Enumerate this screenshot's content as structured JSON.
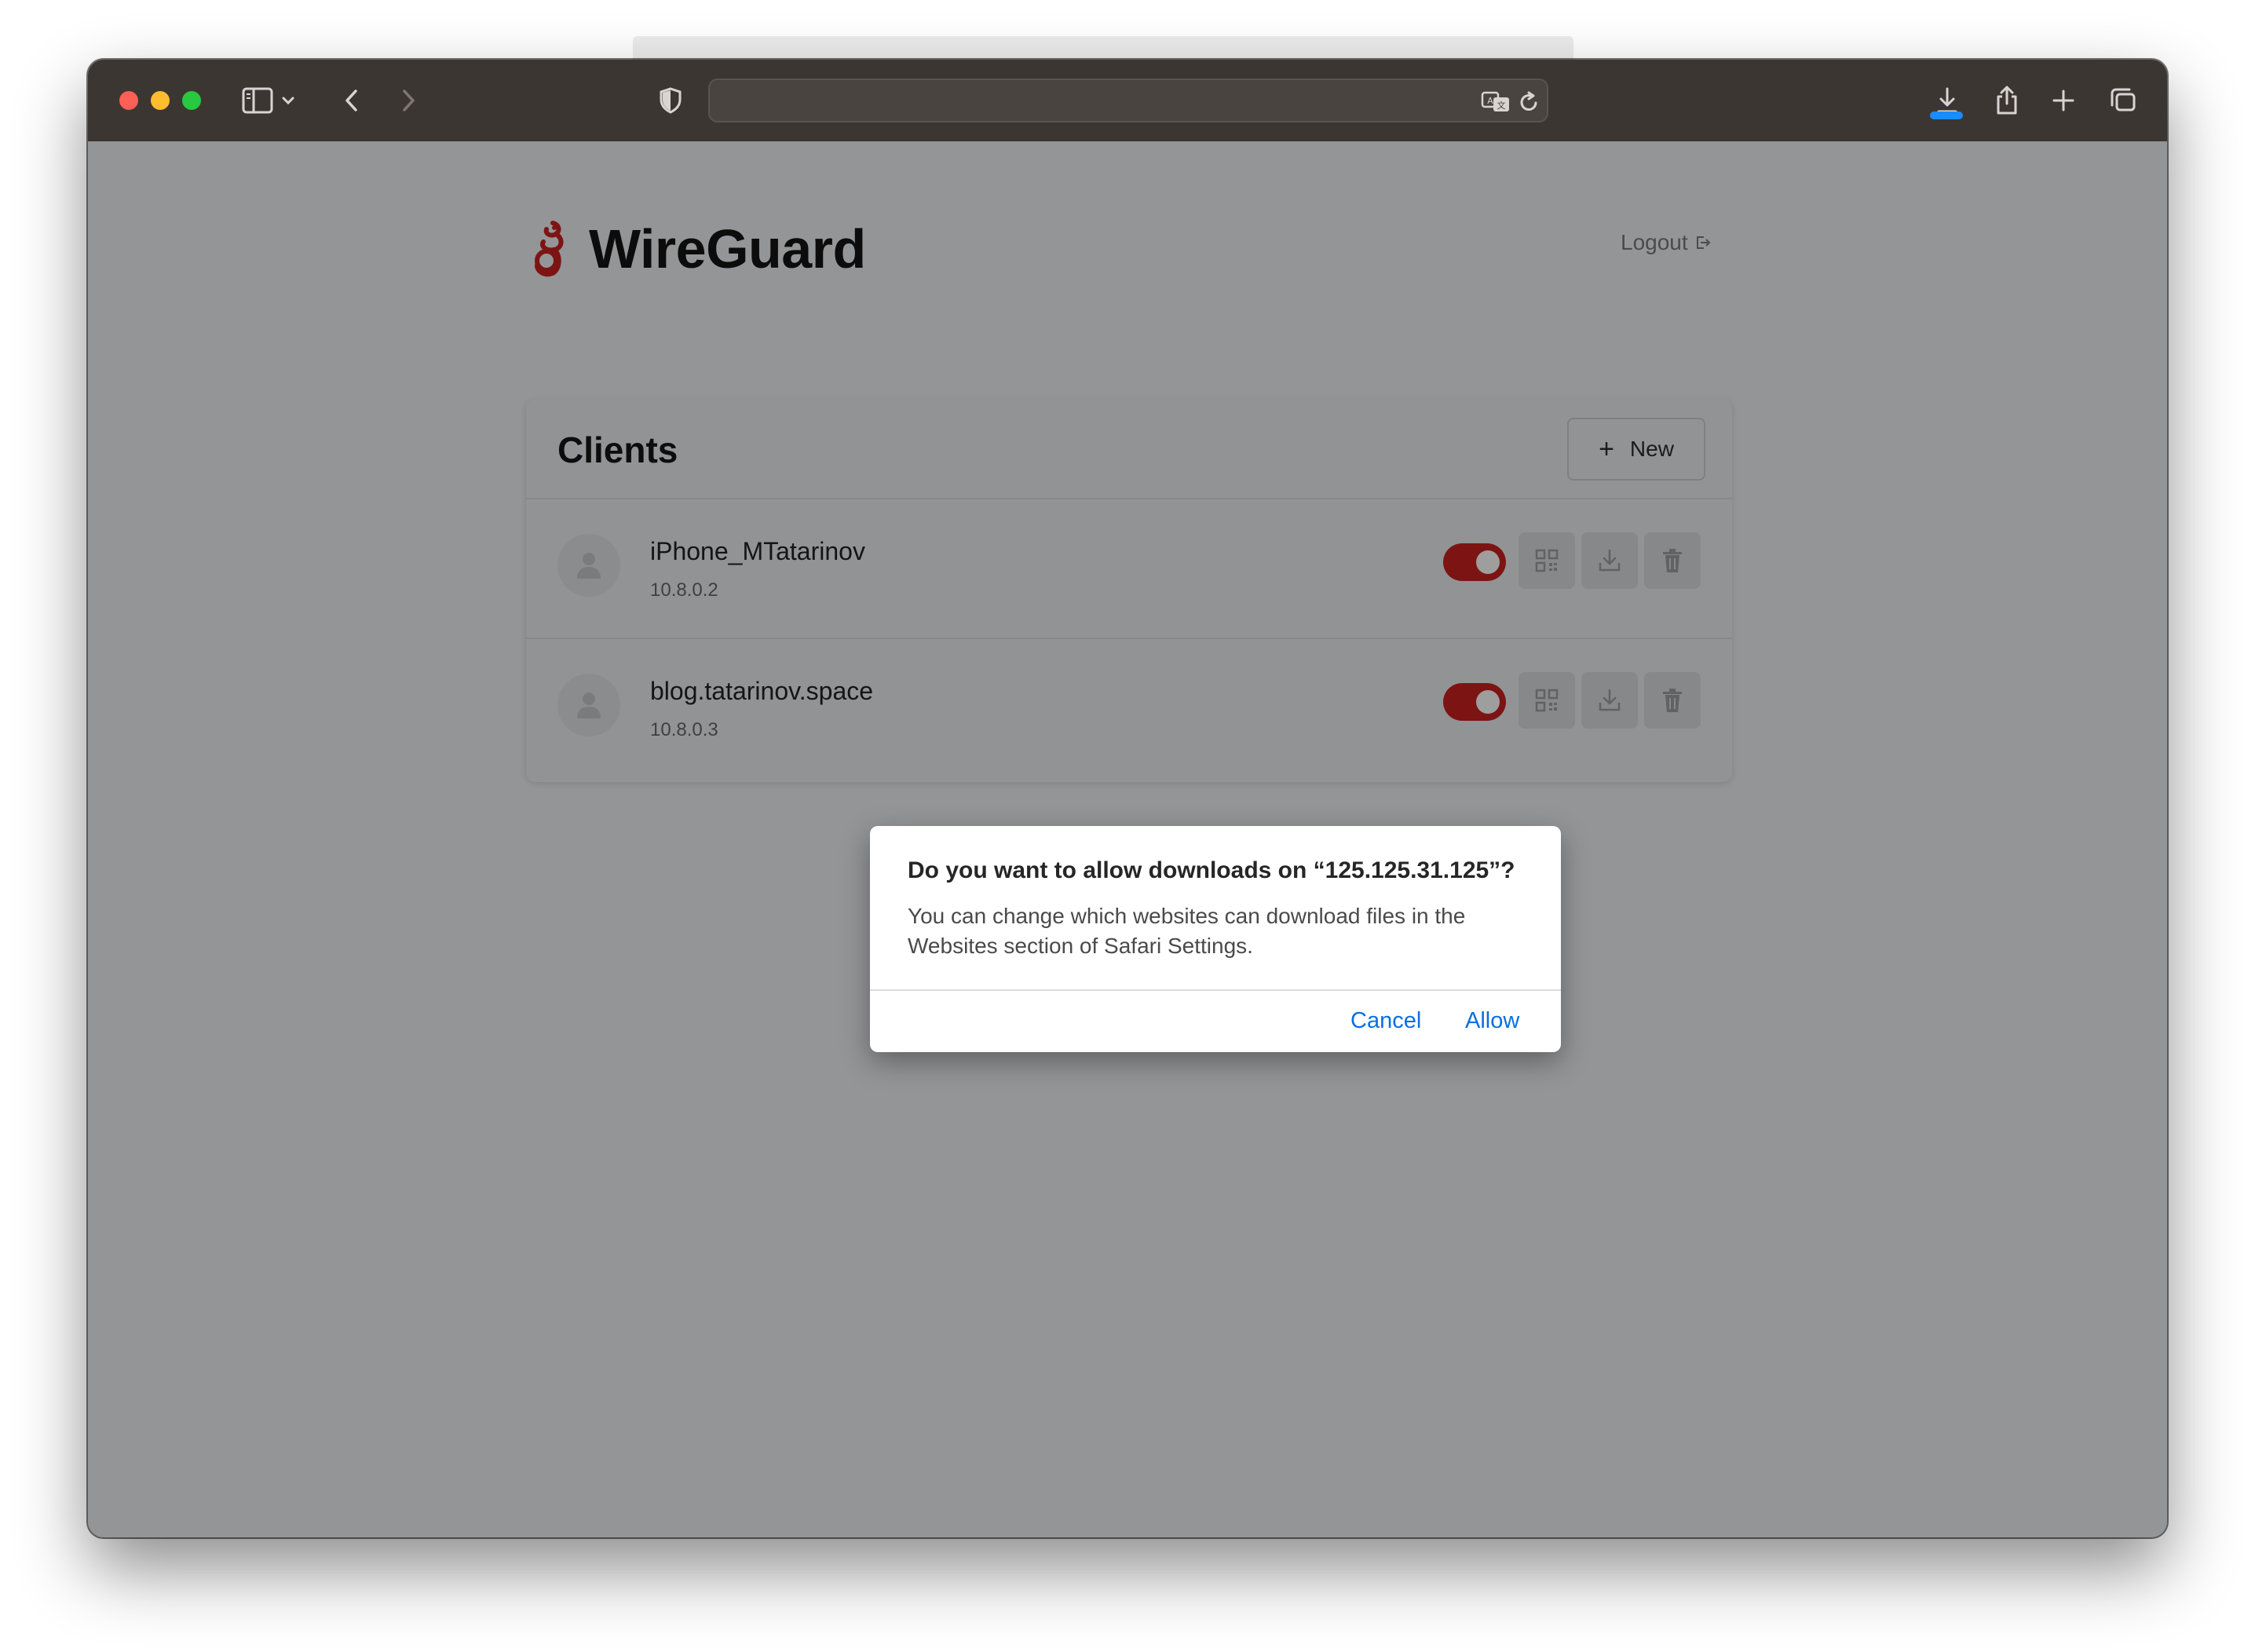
{
  "browser": {
    "address": "",
    "icons": [
      "sidebar-icon",
      "chevron-down-icon",
      "back-icon",
      "forward-icon",
      "shield-icon",
      "translate-icon",
      "reload-icon",
      "downloads-icon",
      "share-icon",
      "new-tab-icon",
      "tabs-overview-icon"
    ]
  },
  "app": {
    "brand": "WireGuard",
    "logout_label": "Logout",
    "accent_color": "#7d1414"
  },
  "clients": {
    "title": "Clients",
    "new_label": "New",
    "items": [
      {
        "name": "iPhone_MTatarinov",
        "ip": "10.8.0.2",
        "enabled": true
      },
      {
        "name": "blog.tatarinov.space",
        "ip": "10.8.0.3",
        "enabled": true
      }
    ]
  },
  "dialog": {
    "title": "Do you want to allow downloads on “125.125.31.125”?",
    "body": "You can change which websites can download files in the Websites section of Safari Settings.",
    "cancel_label": "Cancel",
    "allow_label": "Allow",
    "link_color": "#0a6fe0"
  }
}
